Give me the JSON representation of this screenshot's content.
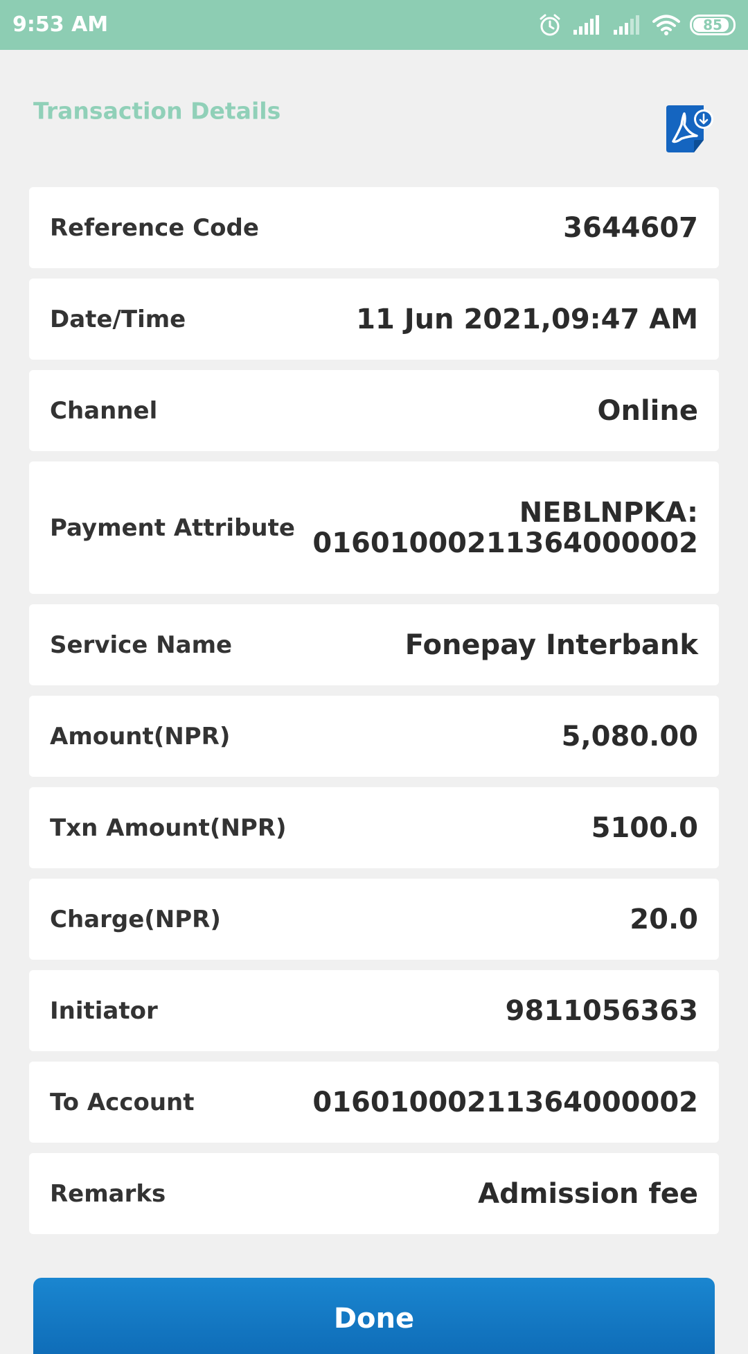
{
  "status_bar": {
    "time": "9:53 AM",
    "battery_level": "85",
    "icons": [
      "alarm-icon",
      "signal-icon",
      "signal-icon",
      "wifi-icon",
      "battery-icon"
    ]
  },
  "header": {
    "title": "Transaction Details",
    "pdf_icon": "pdf-download-icon"
  },
  "details": [
    {
      "label": "Reference Code",
      "value": "3644607"
    },
    {
      "label": "Date/Time",
      "value": "11 Jun 2021,09:47 AM"
    },
    {
      "label": "Channel",
      "value": "Online"
    },
    {
      "label": "Payment Attribute",
      "value_line1": "NEBLNPKA:",
      "value_line2": "01601000211364000002"
    },
    {
      "label": "Service Name",
      "value": "Fonepay Interbank"
    },
    {
      "label": "Amount(NPR)",
      "value": "5,080.00"
    },
    {
      "label": "Txn Amount(NPR)",
      "value": "5100.0"
    },
    {
      "label": "Charge(NPR)",
      "value": "20.0"
    },
    {
      "label": "Initiator",
      "value": "9811056363"
    },
    {
      "label": "To Account",
      "value": "01601000211364000002"
    },
    {
      "label": "Remarks",
      "value": "Admission fee"
    }
  ],
  "done_label": "Done",
  "colors": {
    "status_bar": "#8dcdb3",
    "title": "#90d0b8",
    "pdf_icon": "#1565c0",
    "button": "#1a86d0"
  }
}
